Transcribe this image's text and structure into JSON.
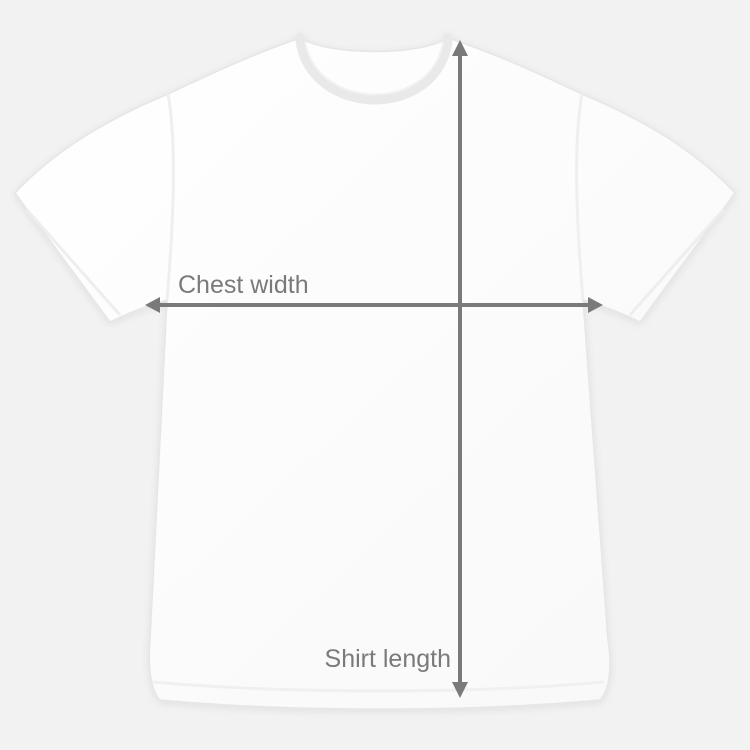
{
  "diagram": {
    "labels": {
      "chest_width": "Chest width",
      "shirt_length": "Shirt length"
    },
    "colors": {
      "background": "#f2f2f2",
      "shirt": "#ffffff",
      "shirt_outline": "#e8e8e8",
      "arrow": "#7a7a7a",
      "label": "#7a7a7a"
    },
    "icons": {
      "garment": "t-shirt-icon",
      "horizontal_measure": "double-arrow-horizontal-icon",
      "vertical_measure": "double-arrow-vertical-icon"
    }
  }
}
